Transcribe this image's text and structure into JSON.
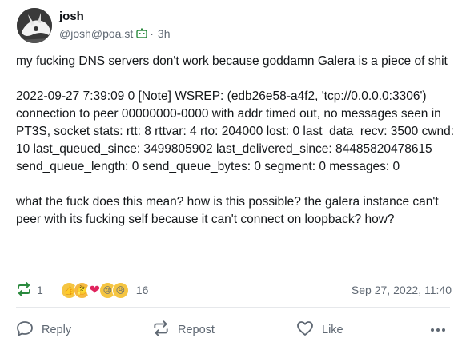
{
  "author": {
    "display_name": "josh",
    "handle": "@josh@poa.st",
    "bot_icon": "bot-icon",
    "separator": "·",
    "relative_time": "3h"
  },
  "post": {
    "paragraphs": [
      "my fucking DNS servers don't work because goddamn Galera is a piece of shit",
      "2022-09-27 7:39:09 0 [Note] WSREP: (edb26e58-a4f2, 'tcp://0.0.0.0:3306') connection to peer 00000000-0000 with addr timed out, no messages seen in PT3S, socket stats: rtt: 8 rttvar: 4 rto: 204000 lost: 0 last_data_recv: 3500 cwnd: 10 last_queued_since: 3499805902 last_delivered_since: 84485820478615 send_queue_length: 0 send_queue_bytes: 0 segment: 0 messages: 0",
      "what the fuck does this mean? how is this possible? the galera instance can't peer with its fucking self because it can't connect on loopback? how?"
    ]
  },
  "stats": {
    "boost_icon": "repost-icon",
    "boost_count": "1",
    "reactions": [
      {
        "icon": "thumbs-up-emoji",
        "glyph": "👍",
        "color": "#f5c542"
      },
      {
        "icon": "thinking-emoji",
        "glyph": "🤔",
        "color": "#f5b942"
      },
      {
        "icon": "red-heart-emoji",
        "glyph": "❤",
        "color": "#e0245e"
      },
      {
        "icon": "crying-emoji",
        "glyph": "😢",
        "color": "#f5c542"
      },
      {
        "icon": "weary-emoji",
        "glyph": "😩",
        "color": "#f5c542"
      }
    ],
    "reaction_count": "16",
    "timestamp": "Sep 27, 2022, 11:40"
  },
  "actions": {
    "reply_label": "Reply",
    "repost_label": "Repost",
    "like_label": "Like",
    "more_icon": "more-icon"
  },
  "colors": {
    "boost_green": "#2b8a3e",
    "muted_text": "#5f6873",
    "divider": "#e6e8eb"
  }
}
